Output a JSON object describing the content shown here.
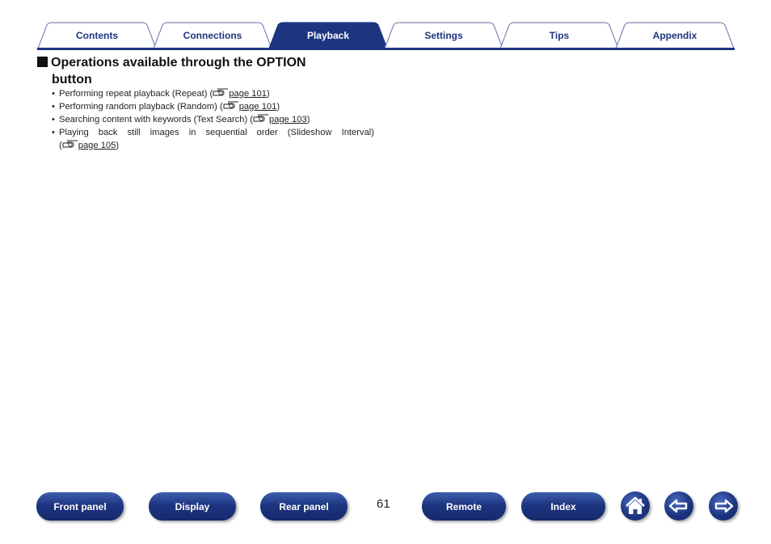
{
  "tabs": [
    {
      "label": "Contents",
      "active": false
    },
    {
      "label": "Connections",
      "active": false
    },
    {
      "label": "Playback",
      "active": true
    },
    {
      "label": "Settings",
      "active": false
    },
    {
      "label": "Tips",
      "active": false
    },
    {
      "label": "Appendix",
      "active": false
    }
  ],
  "section": {
    "heading_line1": "Operations available through the OPTION",
    "heading_line2": "button",
    "items": [
      {
        "text": "Performing repeat playback (Repeat) (",
        "ref_icon": "pointing-hand-icon",
        "link": "page 101",
        "close": ")"
      },
      {
        "text": "Performing random playback (Random) (",
        "ref_icon": "pointing-hand-icon",
        "link": "page 101",
        "close": ")"
      },
      {
        "text": "Searching content with keywords (Text Search) (",
        "ref_icon": "pointing-hand-icon",
        "link": "page 103",
        "close": ")"
      },
      {
        "text": "Playing back still images in sequential order (Slideshow Interval)",
        "text2": "(",
        "ref_icon": "pointing-hand-icon",
        "link": "page 105",
        "close": ")"
      }
    ],
    "bullet": "•"
  },
  "footer": {
    "buttons": [
      "Front panel",
      "Display",
      "Rear panel",
      "Remote",
      "Index"
    ],
    "page_number": "61",
    "icons": [
      "home-icon",
      "back-arrow-icon",
      "forward-arrow-icon"
    ]
  },
  "colors": {
    "brand": "#1d3580",
    "tab_border": "#7f86b6"
  }
}
